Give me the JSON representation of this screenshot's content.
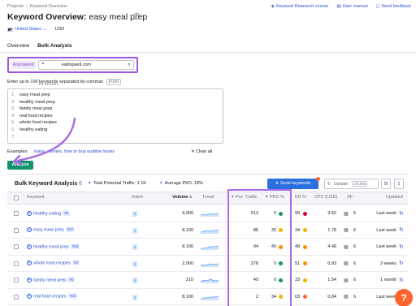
{
  "breadcrumb": [
    "Projects",
    "Keyword Overview"
  ],
  "title": "Keyword Overview:",
  "title_keyword": "easy meal prep",
  "top_links": {
    "research": "Keyword Research course",
    "manual": "User manual",
    "feedback": "Send feedback"
  },
  "database": "United States",
  "currency": "USD",
  "tabs": [
    "Overview",
    "Bulk Analysis"
  ],
  "ai": {
    "badge": "AI-powered",
    "domain": "eatingwell.com"
  },
  "enter": {
    "prefix": "Enter up to 100",
    "link": "keywords",
    "suffix": "separated by commas",
    "count": "6/100"
  },
  "keywords_input": [
    "easy meal prep",
    "healthy meal prep",
    "family meal prep",
    "real food recipes",
    "whole food recipes",
    "healthy eating",
    ""
  ],
  "examples": {
    "label": "Examples:",
    "text": "loans, movies, how to buy audible books"
  },
  "clear_all": "Clear all",
  "analyze": "Analyze",
  "results": {
    "title": "Bulk Keyword Analysis",
    "count": "6",
    "potential_traffic": "Total Potential Traffic: 1.1K",
    "avg_pkd": "Average PKD: 18%",
    "send_keywords": "Send keywords",
    "update": "Update",
    "update_limit": "1/5,000"
  },
  "columns": [
    "Keyword",
    "Intent",
    "Volume",
    "Trend",
    "Pot. Traffic",
    "PKD %",
    "KD %",
    "CPC (USD)",
    "SF",
    "Updated"
  ],
  "rows": [
    {
      "keyword": "healthy eating",
      "tag": "#5",
      "intent": "I",
      "volume": "9,900",
      "traffic": "613",
      "pkd": "0",
      "pkd_color": "#14916d",
      "kd": "99",
      "kd_color": "#d1002f",
      "cpc": "3.52",
      "sf": "6",
      "updated": "Last week"
    },
    {
      "keyword": "easy meal prep",
      "tag": "#27",
      "intent": "I",
      "volume": "8,100",
      "traffic": "85",
      "pkd": "32",
      "pkd_color": "#f5b400",
      "kd": "34",
      "kd_color": "#f5b400",
      "cpc": "1.78",
      "sf": "6",
      "updated": "Last week"
    },
    {
      "keyword": "healthy meal prep",
      "tag": "#23",
      "intent": "I",
      "volume": "8,100",
      "traffic": "94",
      "pkd": "40",
      "pkd_color": "#ff8c00",
      "kd": "48",
      "kd_color": "#ff8c00",
      "cpc": "4.48",
      "sf": "6",
      "updated": "Last week"
    },
    {
      "keyword": "whole food recipes",
      "tag": "#3",
      "intent": "I",
      "volume": "2,900",
      "traffic": "278",
      "pkd": "0",
      "pkd_color": "#14916d",
      "kd": "51",
      "kd_color": "#ff8c00",
      "cpc": "0.93",
      "sf": "6",
      "updated": "2 weeks"
    },
    {
      "keyword": "family meal prep",
      "tag": "#2",
      "intent": "I",
      "volume": "210",
      "traffic": "49",
      "pkd": "0",
      "pkd_color": "#14916d",
      "kd": "33",
      "kd_color": "#f5b400",
      "cpc": "1.54",
      "sf": "6",
      "updated": "1 month"
    },
    {
      "keyword": "real food recipes",
      "tag": "#23",
      "intent": "I",
      "volume": "8,100",
      "traffic": "2",
      "pkd": "34",
      "pkd_color": "#f5b400",
      "kd": "63",
      "kd_color": "#ff642d",
      "cpc": "0.84",
      "sf": "6",
      "updated": "Last week"
    }
  ],
  "colors": {
    "accent_blue": "#2a6fde",
    "accent_purple": "#9b57e0",
    "analyze_green": "#14916d",
    "help_orange": "#ff642d"
  },
  "help": "?"
}
